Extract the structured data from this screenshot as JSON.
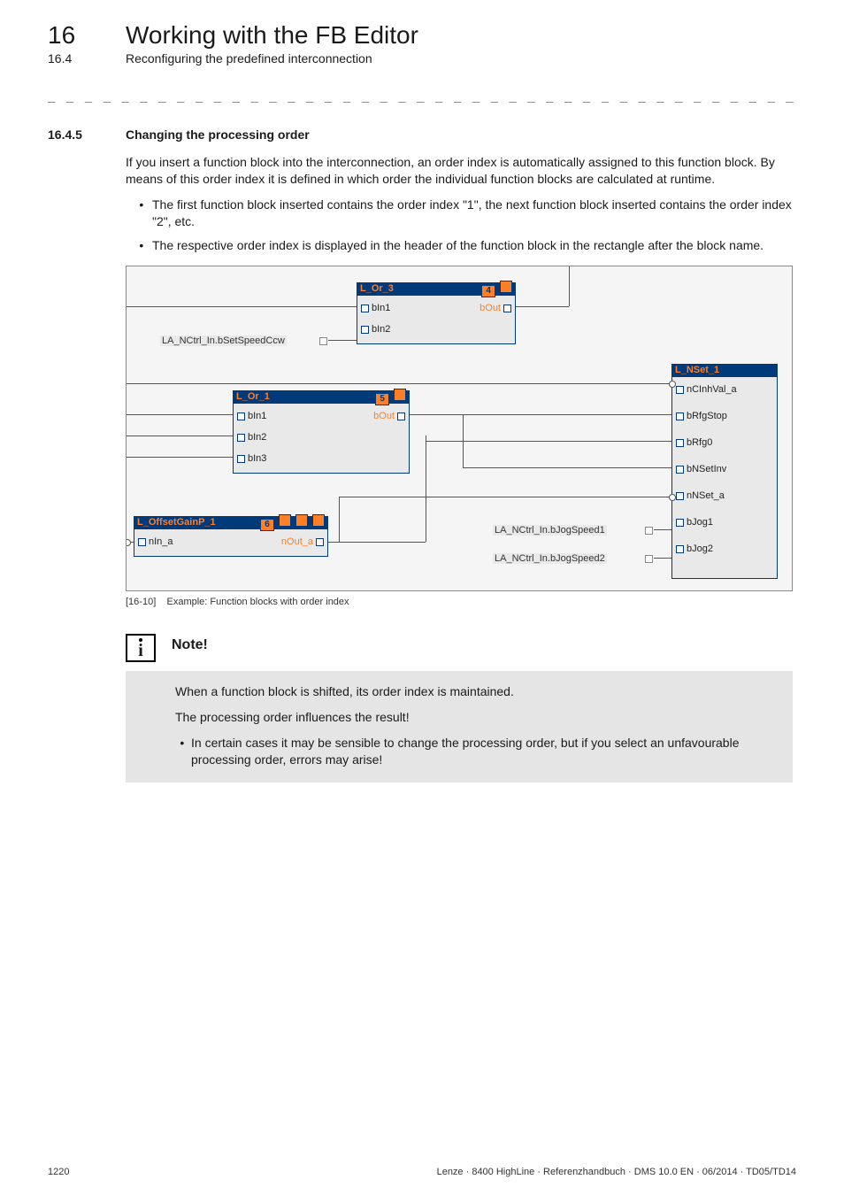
{
  "chapter": {
    "num": "16",
    "title": "Working with the FB Editor"
  },
  "subchapter": {
    "num": "16.4",
    "title": "Reconfiguring the predefined interconnection"
  },
  "dashes": "_ _ _ _ _ _ _ _ _ _ _ _ _ _ _ _ _ _ _ _ _ _ _ _ _ _ _ _ _ _ _ _ _ _ _ _ _ _ _ _ _ _ _ _ _ _ _ _ _ _ _ _ _ _ _ _ _ _ _ _ _ _ _ _",
  "section": {
    "num": "16.4.5",
    "title": "Changing the processing order"
  },
  "para1": "If you insert a function block into the interconnection, an order index is automatically assigned to this function block. By means of this order index it is defined in which order the individual function blocks are calculated at runtime.",
  "bullets": [
    "The first function block inserted contains the order index \"1\", the next function block inserted contains the order index \"2\", etc.",
    "The respective order index is displayed in the header of the function block in the rectangle after the block name."
  ],
  "figure": {
    "caption_id": "[16-10]",
    "caption_text": "Example: Function blocks with order index",
    "ext_left": "LA_NCtrl_In.bSetSpeedCcw",
    "ext_jog1": "LA_NCtrl_In.bJogSpeed1",
    "ext_jog2": "LA_NCtrl_In.bJogSpeed2",
    "fb_or3": {
      "name": "L_Or_3",
      "idx": "4",
      "in1": "bIn1",
      "in2": "bIn2",
      "out": "bOut"
    },
    "fb_or1": {
      "name": "L_Or_1",
      "idx": "5",
      "in1": "bIn1",
      "in2": "bIn2",
      "in3": "bIn3",
      "out": "bOut"
    },
    "fb_off": {
      "name": "L_OffsetGainP_1",
      "idx": "6",
      "in": "nIn_a",
      "out": "nOut_a"
    },
    "fb_nset": {
      "name": "L_NSet_1",
      "p1": "nCInhVal_a",
      "p2": "bRfgStop",
      "p3": "bRfg0",
      "p4": "bNSetInv",
      "p5": "nNSet_a",
      "p6": "bJog1",
      "p7": "bJog2"
    }
  },
  "note": {
    "title": "Note!",
    "p1": "When a function block is shifted, its order index is maintained.",
    "p2": "The processing order influences the result!",
    "li": "In certain cases it may be sensible to change the processing order, but if you select an unfavourable processing order, errors may arise!"
  },
  "footer": {
    "page": "1220",
    "right": "Lenze · 8400 HighLine · Referenzhandbuch · DMS 10.0 EN · 06/2014 · TD05/TD14"
  }
}
